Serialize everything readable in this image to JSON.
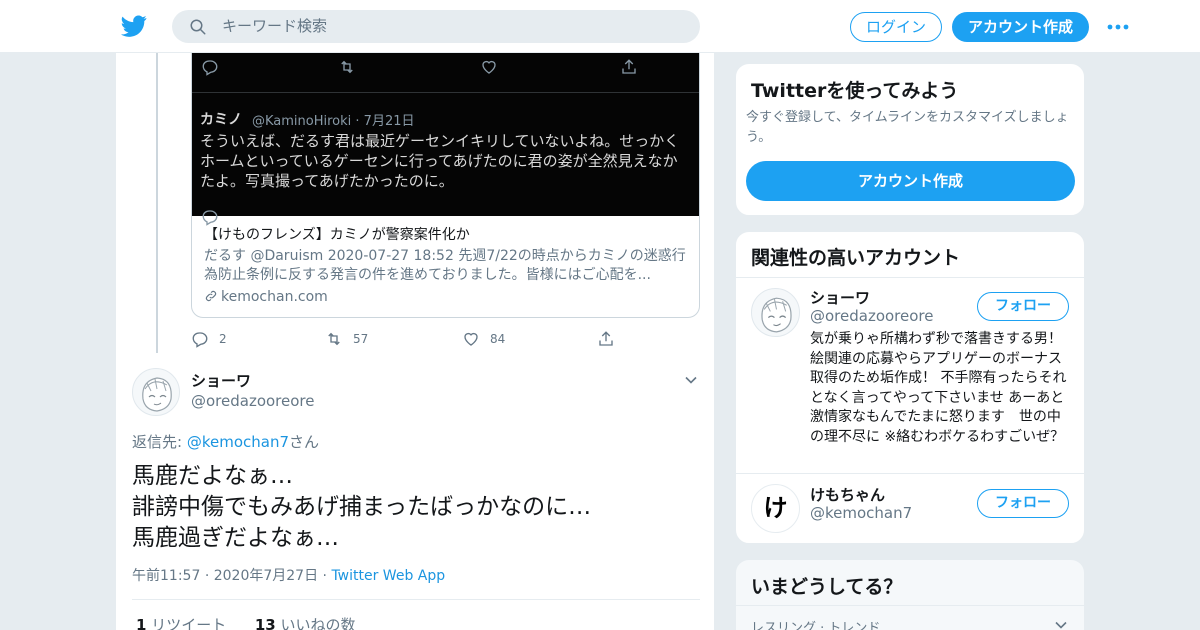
{
  "header": {
    "search_placeholder": "キーワード検索",
    "login_label": "ログイン",
    "signup_label": "アカウント作成"
  },
  "colors": {
    "brand": "#1da1f2",
    "link": "#1b95e0",
    "muted": "#657786",
    "background": "#e6ecf0"
  },
  "quoted_card": {
    "image_tweet": {
      "name": "カミノ",
      "handle_date": "@KaminoHiroki · 7月21日",
      "text": "そういえば、だるす君は最近ゲーセンイキリしていないよね。せっかく\nホームといっているゲーセンに行ってあげたのに君の姿が全然見えなか\nたよ。写真撮ってあげたかったのに。"
    },
    "title": "【けものフレンズ】カミノが警察案件化か",
    "description": "だるす @Daruism 2020-07-27 18:52 先週7/22の時点からカミノの迷惑行為防止条例に反する発言の件を進めておりました。皆様にはご心配を...",
    "domain": "kemochan.com"
  },
  "quoted_actions": {
    "replies": "2",
    "retweets": "57",
    "likes": "84"
  },
  "tweet": {
    "name": "ショーワ",
    "handle": "@oredazooreore",
    "reply_prefix": "返信先: ",
    "reply_mention": "@kemochan7",
    "reply_suffix": "さん",
    "text": "馬鹿だよなぁ…\n誹謗中傷でもみあげ捕まったばっかなのに…\n馬鹿過ぎだよなぁ…",
    "time": "午前11:57",
    "separator": "·",
    "date": "2020年7月27日",
    "app": "Twitter Web App",
    "retweet_count": "1",
    "retweet_label": "リツイート",
    "like_count": "13",
    "like_label": "いいねの数"
  },
  "sidebar": {
    "try_module": {
      "title": "Twitterを使ってみよう",
      "subtitle": "今すぐ登録して、タイムラインをカスタマイズしましょう。",
      "button": "アカウント作成"
    },
    "related_module": {
      "title": "関連性の高いアカウント",
      "accounts": [
        {
          "name": "ショーワ",
          "handle": "@oredazooreore",
          "follow": "フォロー",
          "bio": "気が乗りゃ所構わず秒で落書きする男！ 絵関連の応募やらアプリゲーのボーナス取得のため垢作成！ 不手際有ったらそれとなく言ってやって下さいませ あーあと激情家なもんでたまに怒ります　世の中の理不尽に ※絡むわボケるわすごいぜ？"
        },
        {
          "name": "けもちゃん",
          "handle": "@kemochan7",
          "follow": "フォロー",
          "avatar_glyph": "け"
        }
      ]
    },
    "trends_module": {
      "title": "いまどうしてる？",
      "context": "レスリング · トレンド"
    }
  }
}
